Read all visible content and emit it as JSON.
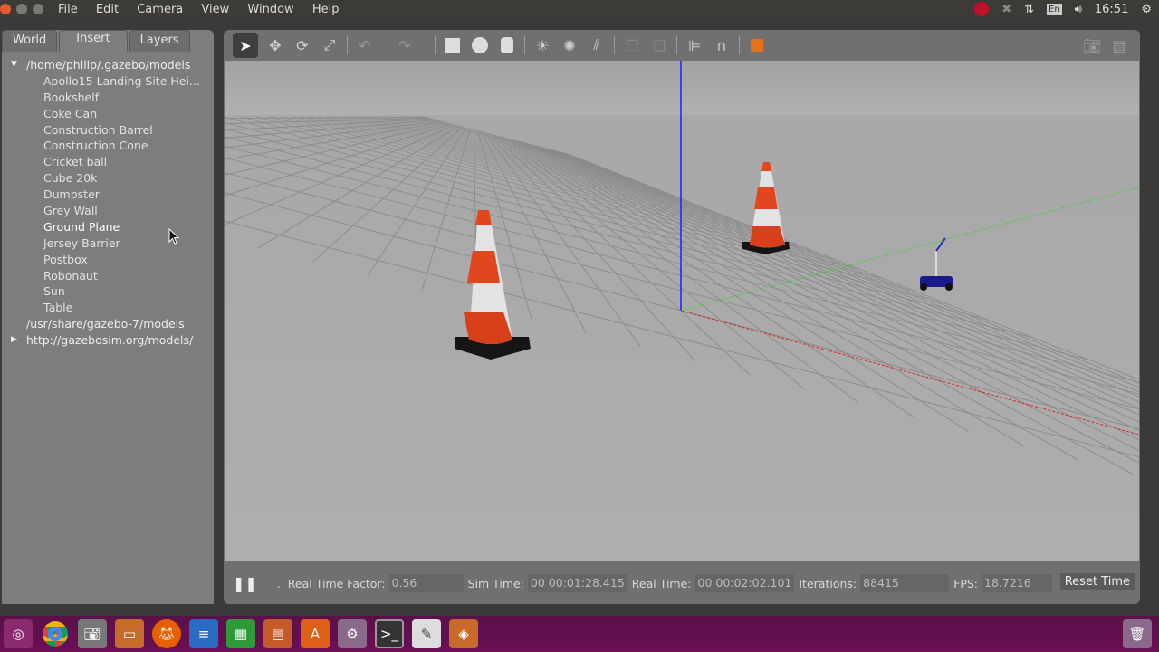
{
  "menubar": {
    "items": [
      "File",
      "Edit",
      "Camera",
      "View",
      "Window",
      "Help"
    ]
  },
  "tray": {
    "keyboard": "En",
    "clock": "16:51"
  },
  "left_panel": {
    "tabs": [
      {
        "label": "World"
      },
      {
        "label": "Insert",
        "active": true
      },
      {
        "label": "Layers"
      }
    ],
    "tree": {
      "root1": "/home/philip/.gazebo/models",
      "items": [
        "Apollo15 Landing Site Hei...",
        "Bookshelf",
        "Coke Can",
        "Construction Barrel",
        "Construction Cone",
        "Cricket ball",
        "Cube 20k",
        "Dumpster",
        "Grey Wall",
        "Ground Plane",
        "Jersey Barrier",
        "Postbox",
        "Robonaut",
        "Sun",
        "Table"
      ],
      "highlighted": "Ground Plane",
      "root2": "/usr/share/gazebo-7/models",
      "root3": "http://gazebosim.org/models/"
    }
  },
  "toolbar": {
    "icons": [
      "select-arrow-icon",
      "translate-icon",
      "rotate-icon",
      "scale-icon",
      "undo-icon",
      "redo-icon",
      "box-icon",
      "sphere-icon",
      "cylinder-icon",
      "point-light-icon",
      "spot-light-icon",
      "directional-light-icon",
      "copy-icon",
      "paste-icon",
      "align-icon",
      "snap-magnet-icon",
      "view-angle-icon"
    ]
  },
  "status": {
    "real_time_factor_label": "Real Time Factor:",
    "real_time_factor": "0.56",
    "sim_time_label": "Sim Time:",
    "sim_time": "00 00:01:28.415",
    "real_time_label": "Real Time:",
    "real_time": "00 00:02:02.101",
    "iterations_label": "Iterations:",
    "iterations": "88415",
    "fps_label": "FPS:",
    "fps": "18.7216",
    "reset_label": "Reset Time"
  },
  "colors": {
    "x_axis": "#e02020",
    "y_axis": "#40d040",
    "z_axis": "#2020ff",
    "cone_orange": "#e2461e",
    "taskbar": "#5e0f4c"
  }
}
